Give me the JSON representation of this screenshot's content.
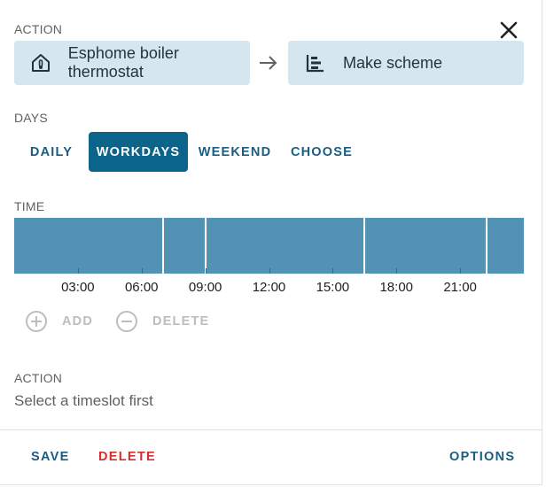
{
  "dialog": {
    "action_label": "ACTION",
    "entity": {
      "name": "Esphome boiler thermostat",
      "icon": "home-thermometer-icon"
    },
    "action": {
      "name": "Make scheme",
      "icon": "format-list-icon"
    },
    "days_label": "DAYS",
    "days": [
      {
        "label": "DAILY",
        "active": false
      },
      {
        "label": "WORKDAYS",
        "active": true
      },
      {
        "label": "WEEKEND",
        "active": false
      },
      {
        "label": "CHOOSE",
        "active": false
      }
    ],
    "time_label": "TIME",
    "time_ticks": [
      "03:00",
      "06:00",
      "09:00",
      "12:00",
      "15:00",
      "18:00",
      "21:00"
    ],
    "slots": [
      {
        "start": "00:00",
        "end": "07:00"
      },
      {
        "start": "07:00",
        "end": "09:00"
      },
      {
        "start": "09:00",
        "end": "16:30"
      },
      {
        "start": "16:30",
        "end": "22:15"
      },
      {
        "start": "22:15",
        "end": "24:00"
      }
    ],
    "add_label": "ADD",
    "delete_slot_label": "DELETE",
    "slot_action_label": "ACTION",
    "slot_hint": "Select a timeslot first",
    "footer": {
      "save": "SAVE",
      "delete": "DELETE",
      "options": "OPTIONS"
    }
  },
  "colors": {
    "primary": "#0b6489",
    "chip_bg": "#d6e6ee",
    "slot": "#5293b5",
    "danger": "#d32f2f",
    "disabled": "#bdbdbd"
  }
}
